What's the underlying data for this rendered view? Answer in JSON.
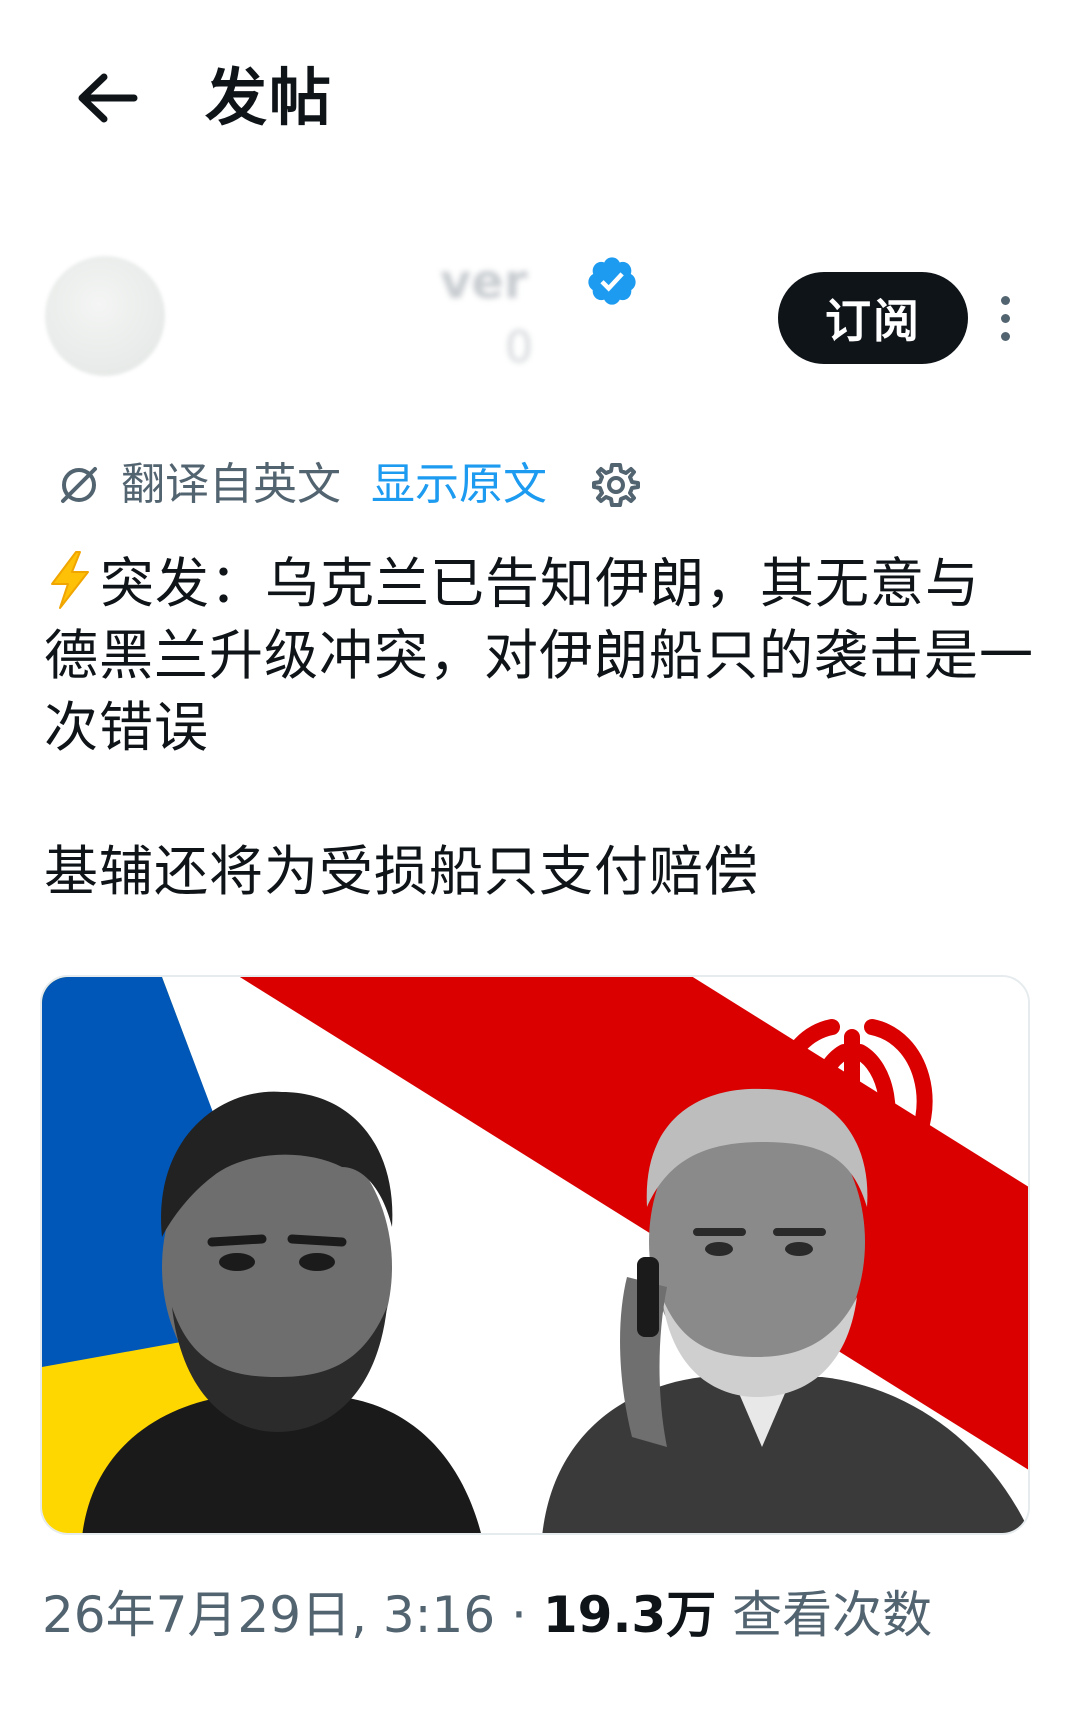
{
  "header": {
    "title": "发帖",
    "back_icon": "arrow-left-icon"
  },
  "author": {
    "name_visible": "ver",
    "handle_visible": "0",
    "verified_icon": "verified-badge-icon",
    "verified_color": "#1d9bf0",
    "subscribe_label": "订阅",
    "more_icon": "more-vertical-icon"
  },
  "translation": {
    "icon": "translate-icon",
    "label": "翻译自英文",
    "show_original": "显示原文",
    "settings_icon": "gear-icon",
    "link_color": "#1d9bf0"
  },
  "post": {
    "emoji": "⚡",
    "text_line1": "突发：乌克兰已告知伊朗，其无意与德黑兰升级冲突，对伊朗船只的袭击是一次错误",
    "text_line2": "基辅还将为受损船只支付赔偿",
    "media": {
      "flags": [
        "ukraine-flag",
        "iran-flag"
      ],
      "colors": {
        "blue": "#0057b8",
        "yellow": "#ffd700",
        "red": "#da0000",
        "green": "#239f40"
      }
    }
  },
  "meta": {
    "date": "26年7月29日",
    "time": "3:16",
    "separator": "·",
    "views_count": "19.3万",
    "views_label": "查看次数"
  }
}
